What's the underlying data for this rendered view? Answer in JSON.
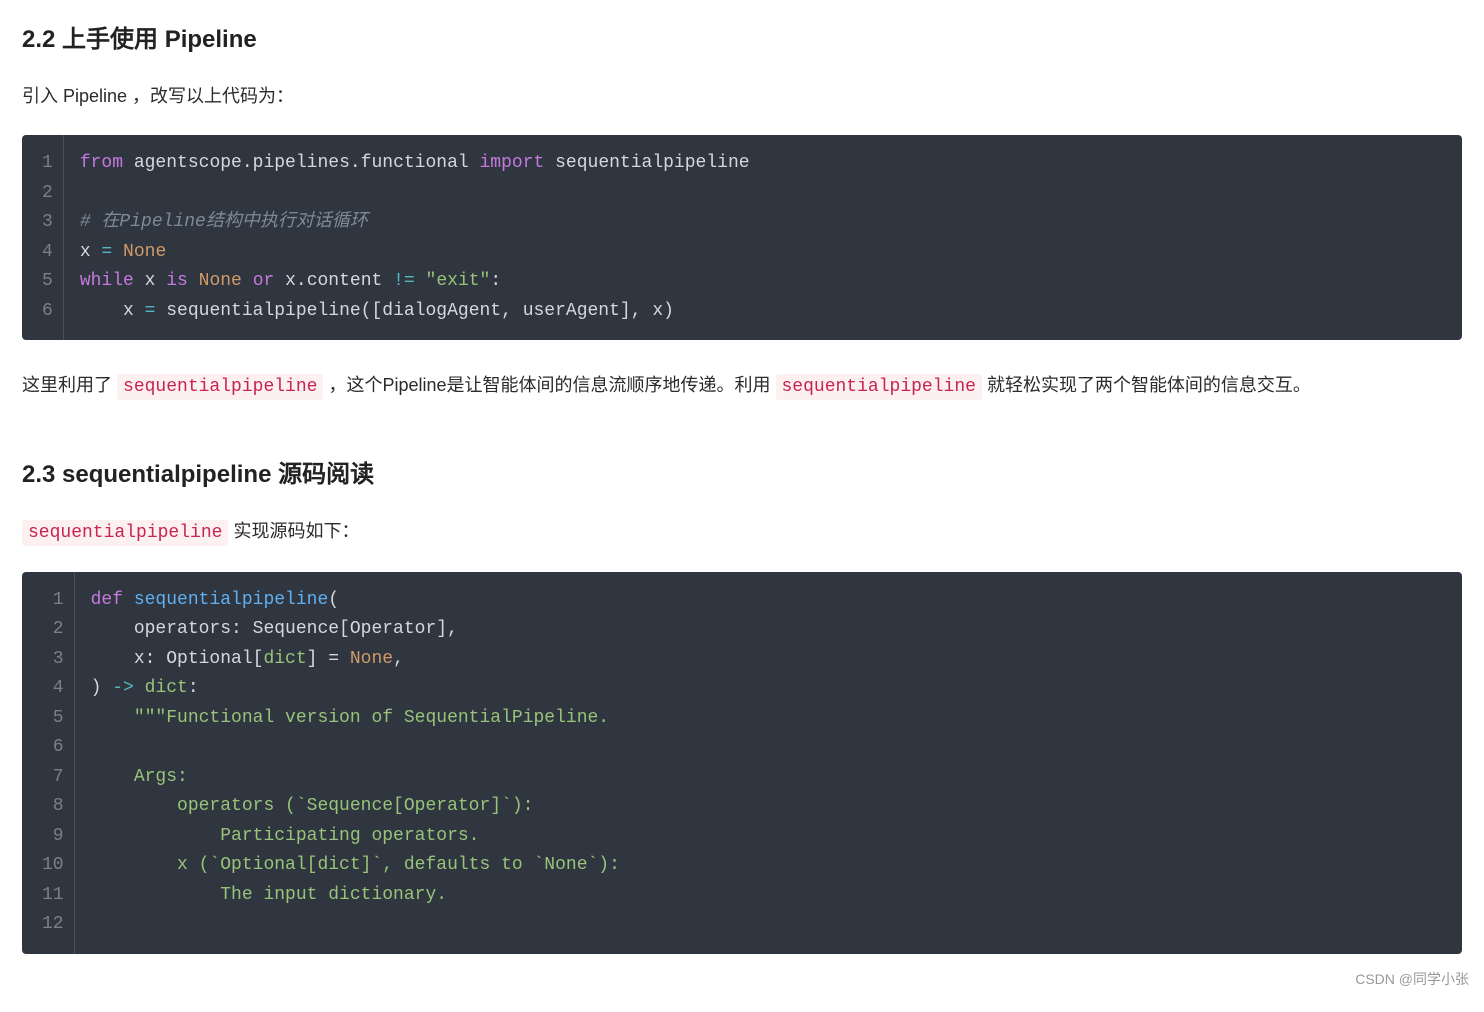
{
  "heading22": "2.2 上手使用 Pipeline",
  "intro22": "引入 Pipeline ，改写以上代码为：",
  "code1": {
    "gutter": "1\n2\n3\n4\n5\n6",
    "tokens": {
      "l1_from": "from",
      "l1_mod": " agentscope.pipelines.functional ",
      "l1_import": "import",
      "l1_name": " sequentialpipeline",
      "l3_comment": "# 在Pipeline结构中执行对话循环",
      "l4_x": "x ",
      "l4_eq": "=",
      "l4_sp": " ",
      "l4_none": "None",
      "l5_while": "while",
      "l5_a": " x ",
      "l5_is": "is",
      "l5_b": " ",
      "l5_none": "None",
      "l5_c": " ",
      "l5_or": "or",
      "l5_d": " x.content ",
      "l5_ne": "!=",
      "l5_e": " ",
      "l5_str": "\"exit\"",
      "l5_colon": ":",
      "l6_indent": "    x ",
      "l6_eq": "=",
      "l6_rest": " sequentialpipeline([dialogAgent, userAgent], x)"
    }
  },
  "para_a_pre": "这里利用了 ",
  "para_a_code1": "sequentialpipeline",
  "para_a_mid": " ，这个Pipeline是让智能体间的信息流顺序地传递。利用 ",
  "para_a_code2": "sequentialpipeline",
  "para_a_post": " 就轻松实现了两个智能体间的信息交互。",
  "heading23": "2.3 sequentialpipeline 源码阅读",
  "para_b_code": "sequentialpipeline",
  "para_b_post": " 实现源码如下：",
  "code2": {
    "gutter": "1\n2\n3\n4\n5\n6\n7\n8\n9\n10\n11\n12",
    "tokens": {
      "l1_def": "def",
      "l1_sp": " ",
      "l1_name": "sequentialpipeline",
      "l1_paren": "(",
      "l2_a": "    operators: Sequence[Operator],",
      "l3_a": "    x: Optional[",
      "l3_dict": "dict",
      "l3_b": "] = ",
      "l3_none": "None",
      "l3_c": ",",
      "l4_a": ") ",
      "l4_arrow": "->",
      "l4_b": " ",
      "l4_dict": "dict",
      "l4_colon": ":",
      "l5_doc": "    \"\"\"Functional version of SequentialPipeline.",
      "l6_blank": "",
      "l7_doc": "    Args:",
      "l8_doc": "        operators (`Sequence[Operator]`):",
      "l9_doc": "            Participating operators.",
      "l10_doc": "        x (`Optional[dict]`, defaults to `None`):",
      "l11_doc": "            The input dictionary.",
      "l12_blank": ""
    }
  },
  "watermark": "CSDN @同学小张"
}
